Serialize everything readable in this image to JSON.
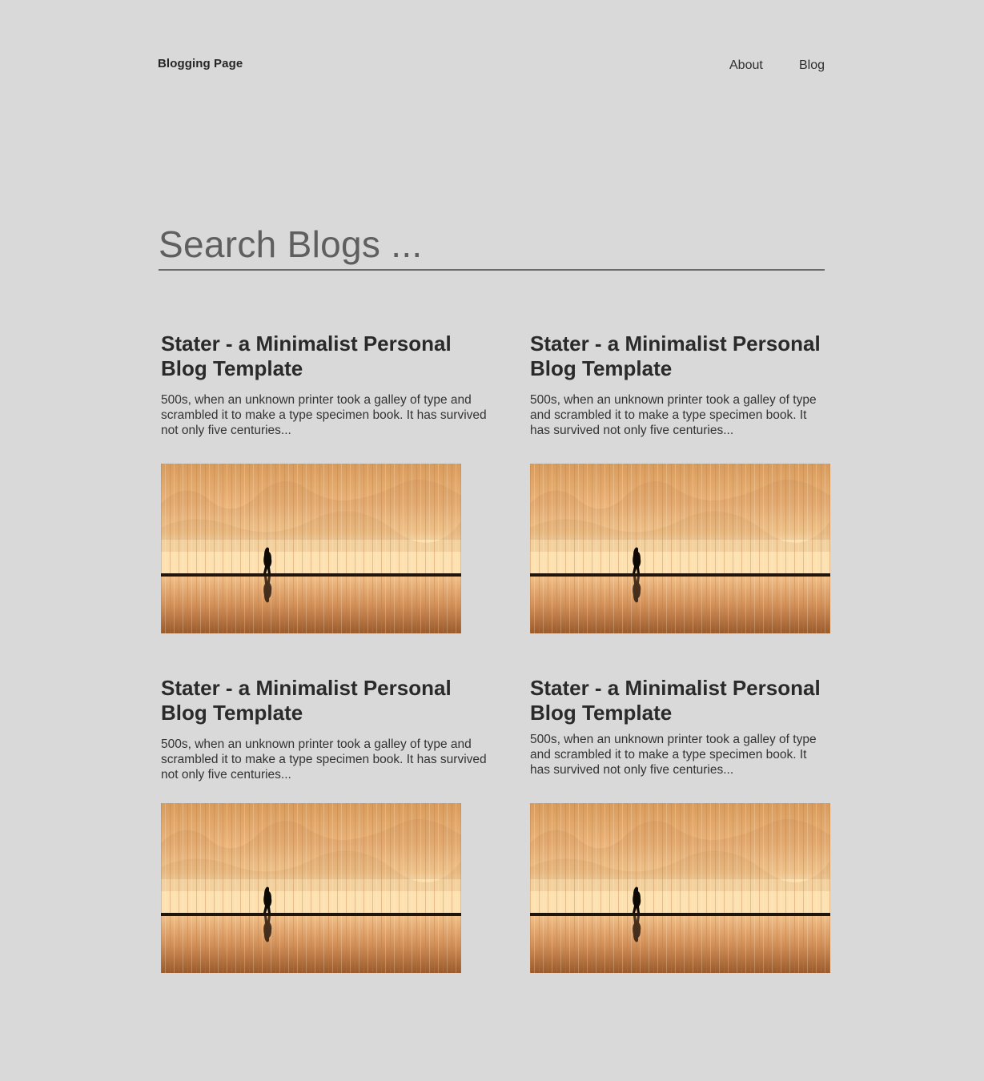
{
  "header": {
    "brand": "Blogging Page",
    "nav": [
      {
        "label": "About"
      },
      {
        "label": "Blog"
      }
    ]
  },
  "search": {
    "placeholder": "Search Blogs ..."
  },
  "posts": [
    {
      "title": "Stater - a Minimalist Personal Blog Template",
      "excerpt": "500s, when an unknown printer took a galley of type and scrambled it to make a type specimen book. It has survived not only five centuries..."
    },
    {
      "title": "Stater - a Minimalist Personal Blog Template",
      "excerpt": "500s, when an unknown printer took a galley of type and scrambled it to make a type specimen book. It has survived not only five centuries..."
    },
    {
      "title": "Stater - a Minimalist Personal Blog Template",
      "excerpt": "500s, when an unknown printer took a galley of type and scrambled it to make a type specimen book. It has survived not only five centuries..."
    },
    {
      "title": "Stater - a Minimalist Personal Blog Template",
      "excerpt": "500s, when an unknown printer took a galley of type and scrambled it to make a type specimen book. It has survived not only five centuries..."
    }
  ],
  "colors": {
    "background": "#d9d9d9",
    "text": "#262626",
    "image_warm_light": "#f6c98c",
    "image_warm_dark": "#9a5a2c"
  }
}
